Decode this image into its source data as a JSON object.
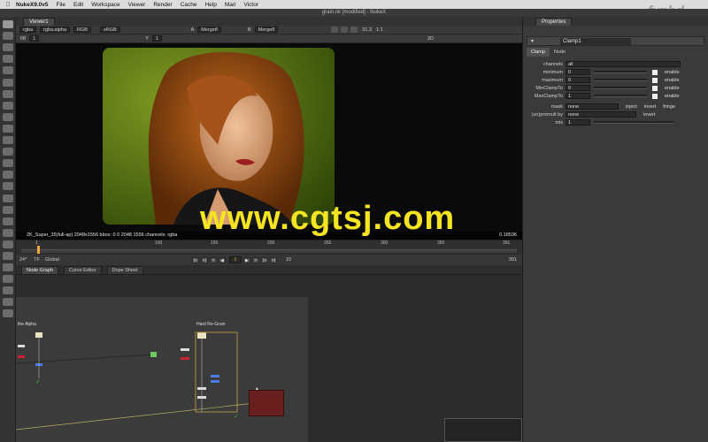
{
  "menubar": {
    "app_name": "NukeX9.0v5",
    "items": [
      "File",
      "Edit",
      "Workspace",
      "Viewer",
      "Render",
      "Cache",
      "Help",
      "Mari",
      "Victor"
    ]
  },
  "window_title": "grain.nk [modified] - NukeX",
  "viewer": {
    "tab_label": "Viewer1",
    "channels": "rgba",
    "alpha": "rgba.alpha",
    "colorspace": "RGB",
    "lut": "sRGB",
    "input_a_label": "A",
    "input_a": "Merge8",
    "input_b_label": "B",
    "input_b": "Merge8",
    "zoom": "31.3",
    "ratio": "1:1",
    "f_stop": "f/8",
    "gain": "1",
    "gamma_label": "Y",
    "gamma": "1",
    "mode": "2D",
    "info": "2K_Super_35(full-ap) 2048x1556  bbox: 0 0 2048 1556 channels: rgba",
    "right_info": "0.18536"
  },
  "watermark": "www.cgtsj.com",
  "timeline": {
    "ticks": [
      "1",
      "100",
      "150",
      "200",
      "250",
      "300",
      "350",
      "391"
    ],
    "fps": "24*",
    "tf": "TF",
    "scope": "Global",
    "current_frame": "1",
    "step": "10",
    "end_frame": "391"
  },
  "node_graph": {
    "tabs": [
      "Node Graph",
      "Curve Editor",
      "Dope Sheet"
    ],
    "backdrop_left": "the Alpha",
    "backdrop_right": "Hard Re-Grain"
  },
  "properties": {
    "panel_title": "Properties",
    "node_name": "Clamp1",
    "subtabs": [
      "Clamp",
      "Node"
    ],
    "channels_label": "channels",
    "channels_value": "all",
    "rows": [
      {
        "label": "minimum",
        "value": "0",
        "enable": "enable"
      },
      {
        "label": "maximum",
        "value": "0",
        "enable": "enable"
      },
      {
        "label": "MinClampTo",
        "value": "0",
        "enable": "enable"
      },
      {
        "label": "MaxClampTo",
        "value": "1",
        "enable": "enable"
      }
    ],
    "mask_label": "mask",
    "mask_value": "none",
    "inject": "inject",
    "invert": "invert",
    "fringe": "fringe",
    "premult_label": "(un)premult by",
    "premult_value": "none",
    "premult_invert": "invert",
    "mix_label": "mix",
    "mix_value": "1"
  },
  "logo": "fxphd"
}
